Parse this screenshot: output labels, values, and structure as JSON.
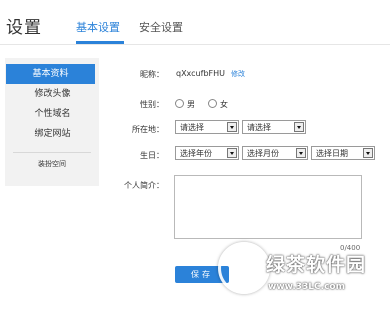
{
  "header": {
    "title": "设置",
    "tabs": [
      {
        "label": "基本设置",
        "active": true
      },
      {
        "label": "安全设置",
        "active": false
      }
    ]
  },
  "sidebar": {
    "items": [
      {
        "label": "基本资料",
        "active": true
      },
      {
        "label": "修改头像",
        "active": false
      },
      {
        "label": "个性域名",
        "active": false
      },
      {
        "label": "绑定网站",
        "active": false
      }
    ],
    "sub_item": "装扮空间"
  },
  "form": {
    "nickname_label": "昵称：",
    "nickname_value": "qXxcufbFHU",
    "nickname_edit": "修改",
    "gender_label": "性别：",
    "gender_male": "男",
    "gender_female": "女",
    "location_label": "所在地：",
    "location_province": "请选择",
    "location_city": "请选择",
    "birthday_label": "生日：",
    "birth_year": "选择年份",
    "birth_month": "选择月份",
    "birth_day": "选择日期",
    "bio_label": "个人简介：",
    "bio_counter": "0/400",
    "save_label": "保存"
  },
  "watermark": {
    "name": "绿茶软件园",
    "url": "www.33LC.com"
  },
  "colors": {
    "accent": "#2b82d9",
    "sidebar_bg": "#f2f2f2"
  }
}
